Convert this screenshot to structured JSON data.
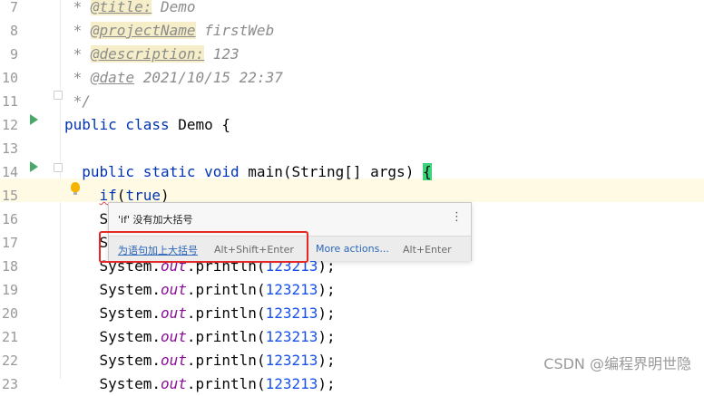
{
  "editor": {
    "lines": [
      {
        "num": "7",
        "parts": [
          [
            "cmt",
            " * "
          ],
          [
            "tag-hl",
            "@title:"
          ],
          [
            "cmt",
            " Demo"
          ]
        ]
      },
      {
        "num": "8",
        "parts": [
          [
            "cmt",
            " * "
          ],
          [
            "tag-hl",
            "@projectName"
          ],
          [
            "cmt",
            " firstWeb"
          ]
        ]
      },
      {
        "num": "9",
        "parts": [
          [
            "cmt",
            " * "
          ],
          [
            "tag-hl",
            "@description:"
          ],
          [
            "cmt",
            " 123"
          ]
        ]
      },
      {
        "num": "10",
        "parts": [
          [
            "cmt",
            " * "
          ],
          [
            "tag",
            "@date"
          ],
          [
            "cmt",
            " 2021/10/15 22:37"
          ]
        ]
      },
      {
        "num": "11",
        "parts": [
          [
            "cmt",
            " */"
          ]
        ]
      },
      {
        "num": "12",
        "parts": [
          [
            "kw",
            "public class "
          ],
          [
            "",
            "Demo {"
          ]
        ]
      },
      {
        "num": "13",
        "parts": []
      },
      {
        "num": "14",
        "parts": [
          [
            "kw",
            "  public static void "
          ],
          [
            "",
            "main(String[] args) "
          ],
          [
            "brace-hl",
            "{"
          ]
        ]
      },
      {
        "num": "15",
        "parts": [
          [
            "",
            "    "
          ],
          [
            "kw squiggle",
            "if"
          ],
          [
            "",
            "("
          ],
          [
            "kw",
            "true"
          ],
          [
            "",
            ")"
          ]
        ]
      },
      {
        "num": "16",
        "parts": [
          [
            "",
            "    S"
          ]
        ]
      },
      {
        "num": "17",
        "parts": [
          [
            "",
            "    S"
          ]
        ]
      },
      {
        "num": "18",
        "parts": [
          [
            "",
            "    System."
          ],
          [
            "out",
            "out"
          ],
          [
            "",
            ".println("
          ],
          [
            "num",
            "123213"
          ],
          [
            "",
            ");"
          ]
        ]
      },
      {
        "num": "19",
        "parts": [
          [
            "",
            "    System."
          ],
          [
            "out",
            "out"
          ],
          [
            "",
            ".println("
          ],
          [
            "num",
            "123213"
          ],
          [
            "",
            ");"
          ]
        ]
      },
      {
        "num": "20",
        "parts": [
          [
            "",
            "    System."
          ],
          [
            "out",
            "out"
          ],
          [
            "",
            ".println("
          ],
          [
            "num",
            "123213"
          ],
          [
            "",
            ");"
          ]
        ]
      },
      {
        "num": "21",
        "parts": [
          [
            "",
            "    System."
          ],
          [
            "out",
            "out"
          ],
          [
            "",
            ".println("
          ],
          [
            "num",
            "123213"
          ],
          [
            "",
            ");"
          ]
        ]
      },
      {
        "num": "22",
        "parts": [
          [
            "",
            "    System."
          ],
          [
            "out",
            "out"
          ],
          [
            "",
            ".println("
          ],
          [
            "num",
            "123213"
          ],
          [
            "",
            ");"
          ]
        ]
      },
      {
        "num": "23",
        "parts": [
          [
            "",
            "    System."
          ],
          [
            "out",
            "out"
          ],
          [
            "",
            ".println("
          ],
          [
            "num",
            "123213"
          ],
          [
            "",
            ");"
          ]
        ]
      }
    ],
    "gutter_icons": [
      {
        "line": "12",
        "icon": "run-icon"
      },
      {
        "line": "14",
        "icon": "run-icon"
      },
      {
        "line": "15",
        "icon": "lightbulb-icon"
      }
    ]
  },
  "popup": {
    "title": "'if' 没有加大括号",
    "menu_icon": "⋮",
    "action_label": "为语句加上大括号",
    "action_shortcut": "Alt+Shift+Enter",
    "more_label": "More actions...",
    "more_shortcut": "Alt+Enter"
  },
  "colors": {
    "keyword": "#0033b3",
    "comment": "#8c8c8c",
    "number": "#1750eb",
    "static_field": "#871094",
    "brace_highlight": "#3bd47c",
    "highlight_box": "#e52727"
  },
  "watermark": "CSDN @编程界明世隐"
}
